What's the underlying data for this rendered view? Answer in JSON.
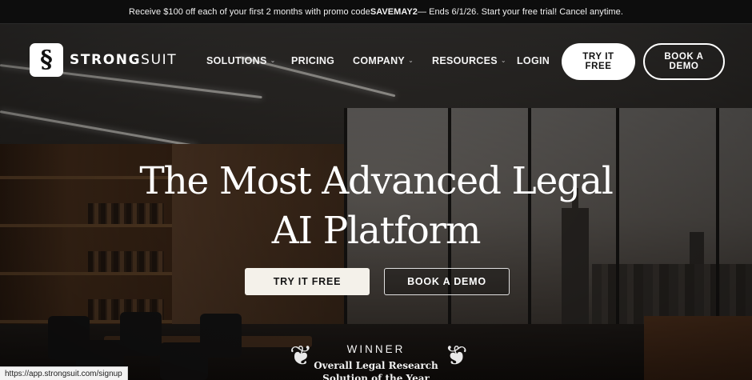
{
  "promo": {
    "prefix": "Receive $100 off each of your first 2 months with promo code ",
    "code": "SAVEMAY2",
    "suffix": " — Ends 6/1/26. Start your free trial! Cancel anytime."
  },
  "logo": {
    "symbol": "§",
    "text_bold": "STRONG",
    "text_light": "SUIT"
  },
  "nav": {
    "items": [
      {
        "label": "SOLUTIONS",
        "has_dropdown": true
      },
      {
        "label": "PRICING",
        "has_dropdown": false
      },
      {
        "label": "COMPANY",
        "has_dropdown": true
      },
      {
        "label": "RESOURCES",
        "has_dropdown": true
      },
      {
        "label": "LOGIN",
        "has_dropdown": false
      }
    ],
    "chevron": "⌄",
    "try_label": "TRY IT\nFREE",
    "demo_label": "BOOK A\nDEMO"
  },
  "hero": {
    "headline_line1": "The Most Advanced Legal",
    "headline_line2": "AI Platform",
    "try_label": "TRY IT FREE",
    "demo_label": "BOOK A DEMO"
  },
  "award": {
    "title": "WINNER",
    "line1": "Overall Legal Research",
    "line2": "Solution of the Year",
    "laurel_left": "❦",
    "laurel_right": "❦"
  },
  "status_bar": {
    "url": "https://app.strongsuit.com/signup"
  },
  "colors": {
    "promo_bg": "#0d0d0d",
    "button_light": "#f4f1ea",
    "text": "#ffffff"
  }
}
